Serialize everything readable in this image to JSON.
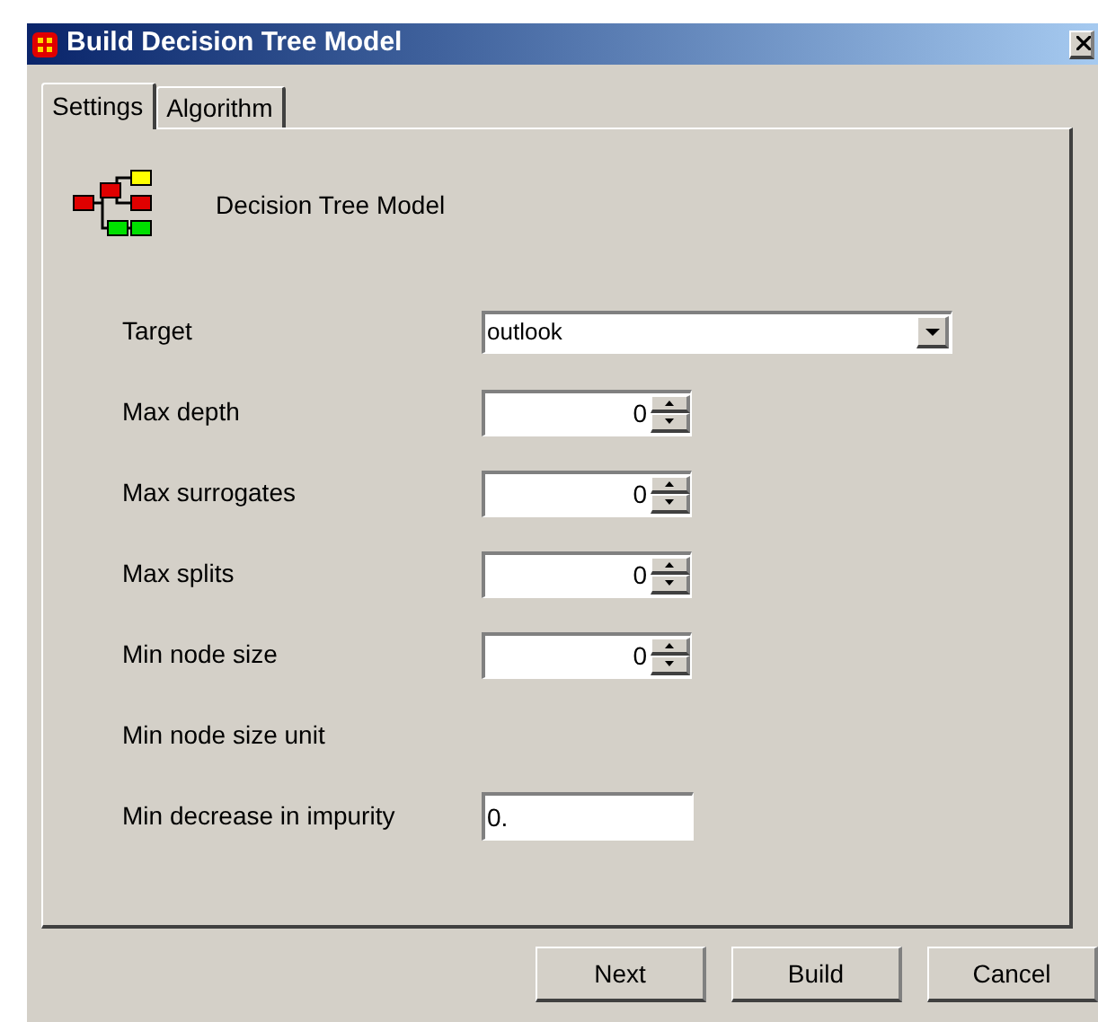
{
  "window": {
    "title": "Build Decision Tree Model"
  },
  "tabs": [
    {
      "label": "Settings",
      "selected": true
    },
    {
      "label": "Algorithm",
      "selected": false
    }
  ],
  "header": {
    "label": "Decision Tree Model"
  },
  "fields": [
    {
      "label": "Target",
      "kind": "combo",
      "value": "outlook"
    },
    {
      "label": "Max depth",
      "kind": "spinner",
      "value": "0"
    },
    {
      "label": "Max surrogates",
      "kind": "spinner",
      "value": "0"
    },
    {
      "label": "Max splits",
      "kind": "spinner",
      "value": "0"
    },
    {
      "label": "Min node size",
      "kind": "spinner",
      "value": "0"
    },
    {
      "label": "Min node size unit",
      "kind": "none"
    },
    {
      "label": "Min decrease in impurity",
      "kind": "text",
      "value": "0."
    }
  ],
  "buttons": [
    "Next",
    "Build",
    "Cancel"
  ]
}
